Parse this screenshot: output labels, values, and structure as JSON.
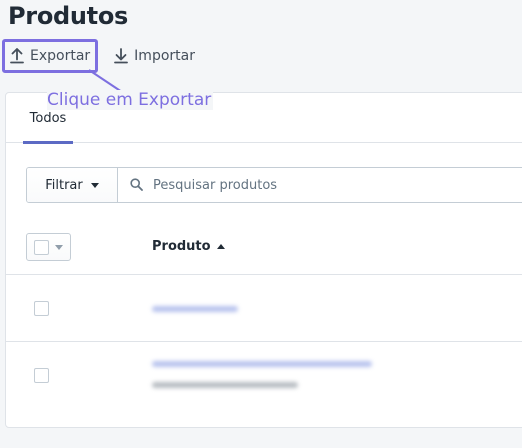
{
  "page": {
    "title": "Produtos"
  },
  "actions": {
    "export_label": "Exportar",
    "import_label": "Importar"
  },
  "callout": {
    "text": "Clique em Exportar",
    "color": "#7d6fe0"
  },
  "tabs": [
    {
      "label": "Todos",
      "selected": true
    }
  ],
  "filter": {
    "button_label": "Filtrar",
    "search_placeholder": "Pesquisar produtos",
    "search_value": ""
  },
  "table": {
    "column_header": "Produto",
    "sort": "ascending",
    "rows": [
      {
        "name": "",
        "name_obscured": true
      },
      {
        "name": "",
        "name_obscured": true,
        "subtitle_obscured": true
      }
    ]
  },
  "colors": {
    "accent": "#5c6ac4",
    "highlight": "#7d6fe0",
    "background": "#f4f6f8"
  },
  "icons": {
    "export": "upload-icon",
    "import": "download-icon",
    "search": "search-icon"
  }
}
